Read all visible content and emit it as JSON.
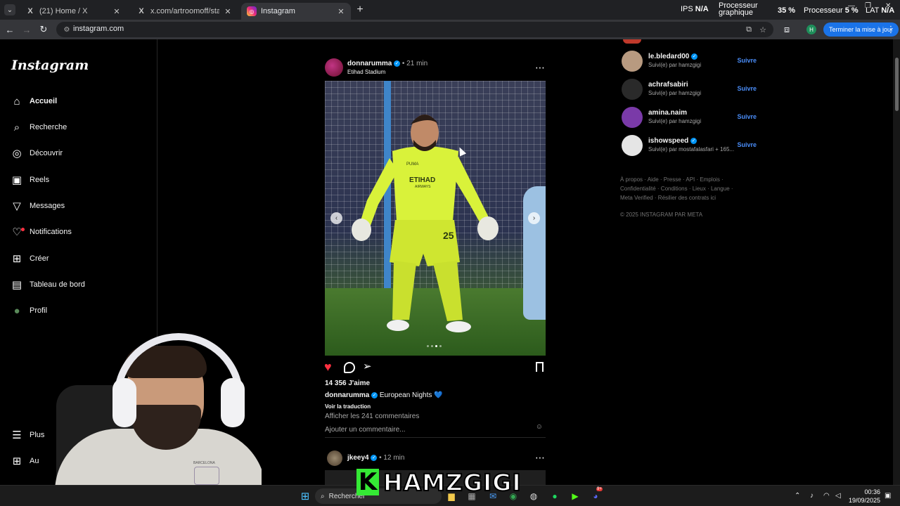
{
  "browser": {
    "tabs": [
      {
        "title": "(21) Home / X",
        "icon": "x-logo-icon"
      },
      {
        "title": "x.com/artroomoff/status/19658",
        "icon": "x-logo-icon"
      },
      {
        "title": "Instagram",
        "icon": "instagram-icon",
        "active": true
      }
    ],
    "url": "instagram.com",
    "update_button": "Terminer la mise à jour",
    "profile_initial": "H"
  },
  "hud": {
    "ips_label": "IPS",
    "ips_value": "N/A",
    "gpu_label_1": "Processeur",
    "gpu_label_2": "graphique",
    "gpu_value": "35 %",
    "cpu_label": "Processeur",
    "cpu_value": "5 %",
    "lat_label": "LAT",
    "lat_value": "N/A"
  },
  "sidebar": {
    "logo": "Instagram",
    "items": [
      {
        "label": "Accueil",
        "icon": "home-icon",
        "glyph": "⌂"
      },
      {
        "label": "Recherche",
        "icon": "search-icon",
        "glyph": "⌕"
      },
      {
        "label": "Découvrir",
        "icon": "compass-icon",
        "glyph": "◎"
      },
      {
        "label": "Reels",
        "icon": "reels-icon",
        "glyph": "▣"
      },
      {
        "label": "Messages",
        "icon": "send-icon",
        "glyph": "▽"
      },
      {
        "label": "Notifications",
        "icon": "heart-icon",
        "glyph": "♡"
      },
      {
        "label": "Créer",
        "icon": "plus-square-icon",
        "glyph": "⊞"
      },
      {
        "label": "Tableau de bord",
        "icon": "dashboard-icon",
        "glyph": "▤"
      },
      {
        "label": "Profil",
        "icon": "avatar-icon",
        "glyph": "●"
      }
    ],
    "more": "Plus",
    "also": "Au"
  },
  "post1": {
    "username": "donnarumma",
    "time": "• 21 min",
    "location": "Etihad Stadium",
    "likes": "14 356 J'aime",
    "caption_user": "donnarumma",
    "caption_text": "European Nights 💙",
    "translate": "Voir la traduction",
    "comments": "Afficher les 241 commentaires",
    "add_comment": "Ajouter un commentaire...",
    "jersey_text": "ETIHAD",
    "jersey_sub": "AIRWAYS",
    "jersey_number": "25",
    "jersey_brand": "PUMA"
  },
  "post2": {
    "username": "jkeey4",
    "time": "• 12 min"
  },
  "suggestions": [
    {
      "name": "le.bledard00",
      "verified": true,
      "sub": "Suivi(e) par hamzgigi",
      "follow": "Suivre",
      "color": "#b89a80"
    },
    {
      "name": "achrafsabiri",
      "verified": false,
      "sub": "Suivi(e) par hamzgigi",
      "follow": "Suivre",
      "color": "#2a2a2a"
    },
    {
      "name": "amina.naim",
      "verified": false,
      "sub": "Suivi(e) par hamzgigi",
      "follow": "Suivre",
      "color": "#7a3aa8"
    },
    {
      "name": "ishowspeed",
      "verified": true,
      "sub": "Suivi(e) par mostafalasfari + 165...",
      "follow": "Suivre",
      "color": "#e5e5e5"
    }
  ],
  "footer": {
    "line1": "À propos · Aide · Presse · API · Emplois ·",
    "line2": "Confidentialité · Conditions · Lieux · Langue ·",
    "line3": "Meta Verified · Résilier des contrats ici",
    "copyright": "© 2025 INSTAGRAM PAR META"
  },
  "overlay": {
    "banner_k": "K",
    "banner_text": "HAMZGIGI",
    "badge": "BARCELONA"
  },
  "taskbar": {
    "search": "Rechercher",
    "time": "00:36",
    "date": "19/09/2025",
    "discord_badge": "9+"
  },
  "colors": {
    "like_red": "#ff3040",
    "verified_blue": "#0095f6",
    "follow_blue": "#4a8df8",
    "banner_green": "#35e935",
    "jersey_yellow": "#d9f23a"
  }
}
